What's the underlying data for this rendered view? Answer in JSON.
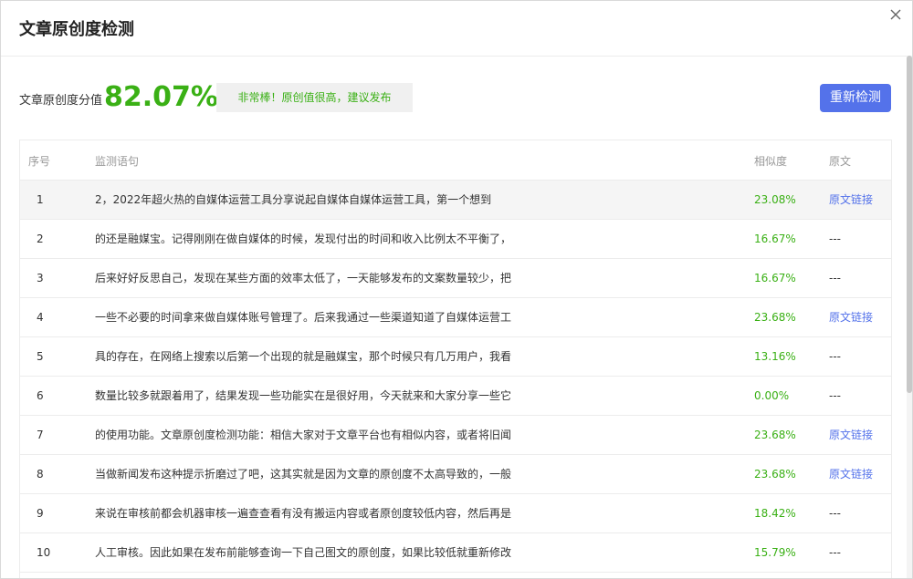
{
  "dialog": {
    "title": "文章原创度检测"
  },
  "score": {
    "label": "文章原创度分值",
    "value": "82.07%",
    "note": "非常棒！原创值很高，建议发布"
  },
  "actions": {
    "recheck": "重新检测"
  },
  "table": {
    "headers": {
      "index": "序号",
      "sentence": "监测语句",
      "similarity": "相似度",
      "source": "原文"
    },
    "rows": [
      {
        "index": "1",
        "sentence": "2，2022年超火热的自媒体运营工具分享说起自媒体自媒体运营工具，第一个想到",
        "similarity": "23.08%",
        "source": "原文链接"
      },
      {
        "index": "2",
        "sentence": "的还是融媒宝。记得刚刚在做自媒体的时候，发现付出的时间和收入比例太不平衡了，",
        "similarity": "16.67%",
        "source": "---"
      },
      {
        "index": "3",
        "sentence": "后来好好反思自己，发现在某些方面的效率太低了，一天能够发布的文案数量较少，把",
        "similarity": "16.67%",
        "source": "---"
      },
      {
        "index": "4",
        "sentence": "一些不必要的时间拿来做自媒体账号管理了。后来我通过一些渠道知道了自媒体运营工",
        "similarity": "23.68%",
        "source": "原文链接"
      },
      {
        "index": "5",
        "sentence": "具的存在，在网络上搜索以后第一个出现的就是融媒宝，那个时候只有几万用户，我看",
        "similarity": "13.16%",
        "source": "---"
      },
      {
        "index": "6",
        "sentence": "数量比较多就跟着用了，结果发现一些功能实在是很好用，今天就来和大家分享一些它",
        "similarity": "0.00%",
        "source": "---"
      },
      {
        "index": "7",
        "sentence": "的使用功能。文章原创度检测功能：相信大家对于文章平台也有相似内容，或者将旧闻",
        "similarity": "23.68%",
        "source": "原文链接"
      },
      {
        "index": "8",
        "sentence": "当做新闻发布这种提示折磨过了吧，这其实就是因为文章的原创度不太高导致的，一般",
        "similarity": "23.68%",
        "source": "原文链接"
      },
      {
        "index": "9",
        "sentence": "来说在审核前都会机器审核一遍查查看有没有搬运内容或者原创度较低内容，然后再是",
        "similarity": "18.42%",
        "source": "---"
      },
      {
        "index": "10",
        "sentence": "人工审核。因此如果在发布前能够查询一下自己图文的原创度，如果比较低就重新修改",
        "similarity": "15.79%",
        "source": "---"
      }
    ]
  },
  "colors": {
    "accent": "#5472ea",
    "score_green": "#3ab015"
  },
  "icons": {
    "close": "close-icon"
  }
}
